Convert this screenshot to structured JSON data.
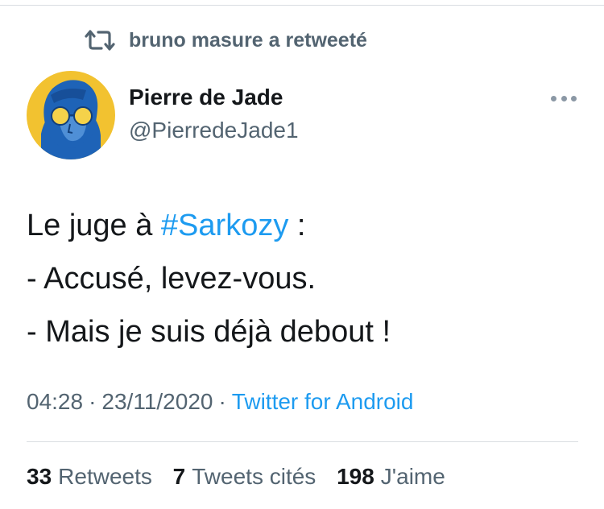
{
  "retweet_context": {
    "icon": "retweet-icon",
    "text": "bruno masure a retweeté"
  },
  "author": {
    "display_name": "Pierre de Jade",
    "handle": "@PierredeJade1",
    "avatar_icon": "avatar-portrait"
  },
  "more_menu": {
    "icon": "more-horizontal-icon"
  },
  "tweet": {
    "line1_prefix": "Le juge à ",
    "hashtag": "#Sarkozy",
    "line1_suffix": " :",
    "line2": "- Accusé, levez-vous.",
    "line3": "- Mais je suis déjà debout !"
  },
  "meta": {
    "time": "04:28",
    "separator": "·",
    "date": "23/11/2020",
    "source": "Twitter for Android"
  },
  "stats": {
    "retweets_count": "33",
    "retweets_label": "Retweets",
    "quotes_count": "7",
    "quotes_label": "Tweets cités",
    "likes_count": "198",
    "likes_label": "J'aime"
  },
  "colors": {
    "link": "#1d9bf0",
    "secondary_text": "#536471",
    "primary_text": "#14171a",
    "avatar_yellow": "#f2c230",
    "avatar_blue": "#1e63b7"
  }
}
